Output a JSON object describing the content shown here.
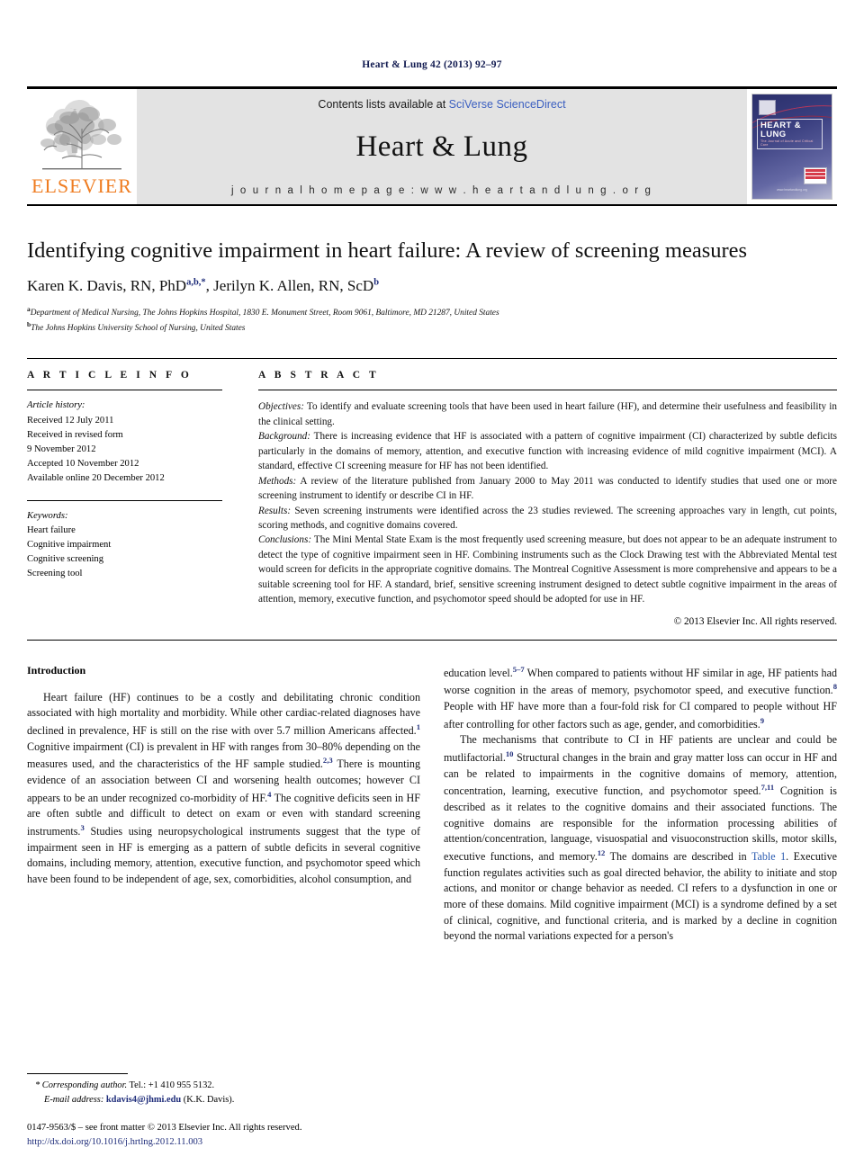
{
  "running_head": "Heart & Lung 42 (2013) 92–97",
  "masthead": {
    "publisher_name": "ELSEVIER",
    "publisher_logo_icon": "elsevier-tree-icon",
    "contents_prefix": "Contents lists available at ",
    "contents_link": "SciVerse ScienceDirect",
    "journal_title": "Heart & Lung",
    "homepage": "j o u r n a l   h o m e p a g e :   w w w . h e a r t a n d l u n g . o r g",
    "cover": {
      "title": "HEART & LUNG",
      "subtitle": "The Journal of Acute and Critical Care",
      "url": "www.heartandlung.org"
    }
  },
  "article": {
    "title": "Identifying cognitive impairment in heart failure: A review of screening measures",
    "authors": [
      {
        "name": "Karen K. Davis, RN, PhD",
        "marks": "a,b,*"
      },
      {
        "name": "Jerilyn K. Allen, RN, ScD",
        "marks": "b"
      }
    ],
    "authors_line_prefix": "Karen K. Davis, RN, PhD",
    "authors_line_mid": ", Jerilyn K. Allen, RN, ScD",
    "affiliations": [
      {
        "mark": "a",
        "text": "Department of Medical Nursing, The Johns Hopkins Hospital, 1830 E. Monument Street, Room 9061, Baltimore, MD 21287, United States"
      },
      {
        "mark": "b",
        "text": "The Johns Hopkins University School of Nursing, United States"
      }
    ]
  },
  "article_info": {
    "heading": "A R T I C L E   I N F O",
    "history_label": "Article history:",
    "history": [
      "Received 12 July 2011",
      "Received in revised form",
      "9 November 2012",
      "Accepted 10 November 2012",
      "Available online 20 December 2012"
    ],
    "keywords_label": "Keywords:",
    "keywords": [
      "Heart failure",
      "Cognitive impairment",
      "Cognitive screening",
      "Screening tool"
    ]
  },
  "abstract": {
    "heading": "A B S T R A C T",
    "sections": [
      {
        "label": "Objectives:",
        "text": " To identify and evaluate screening tools that have been used in heart failure (HF), and determine their usefulness and feasibility in the clinical setting."
      },
      {
        "label": "Background:",
        "text": " There is increasing evidence that HF is associated with a pattern of cognitive impairment (CI) characterized by subtle deficits particularly in the domains of memory, attention, and executive function with increasing evidence of mild cognitive impairment (MCI). A standard, effective CI screening measure for HF has not been identified."
      },
      {
        "label": "Methods:",
        "text": " A review of the literature published from January 2000 to May 2011 was conducted to identify studies that used one or more screening instrument to identify or describe CI in HF."
      },
      {
        "label": "Results:",
        "text": " Seven screening instruments were identified across the 23 studies reviewed. The screening approaches vary in length, cut points, scoring methods, and cognitive domains covered."
      },
      {
        "label": "Conclusions:",
        "text": " The Mini Mental State Exam is the most frequently used screening measure, but does not appear to be an adequate instrument to detect the type of cognitive impairment seen in HF. Combining instruments such as the Clock Drawing test with the Abbreviated Mental test would screen for deficits in the appropriate cognitive domains. The Montreal Cognitive Assessment is more comprehensive and appears to be a suitable screening tool for HF. A standard, brief, sensitive screening instrument designed to detect subtle cognitive impairment in the areas of attention, memory, executive function, and psychomotor speed should be adopted for use in HF."
      }
    ],
    "copyright": "© 2013 Elsevier Inc. All rights reserved."
  },
  "body": {
    "intro_heading": "Introduction",
    "left_paragraph_1_a": "Heart failure (HF) continues to be a costly and debilitating chronic condition associated with high mortality and morbidity. While other cardiac-related diagnoses have declined in prevalence, HF is still on the rise with over 5.7 million Americans affected.",
    "left_ref_1": "1",
    "left_paragraph_1_b": " Cognitive impairment (CI) is prevalent in HF with ranges from 30–80% depending on the measures used, and the characteristics of the HF sample studied.",
    "left_ref_2": "2,3",
    "left_paragraph_1_c": " There is mounting evidence of an association between CI and worsening health outcomes; however CI appears to be an under recognized co-morbidity of HF.",
    "left_ref_3": "4",
    "left_paragraph_1_d": " The cognitive deficits seen in HF are often subtle and difficult to detect on exam or even with standard screening instruments.",
    "left_ref_4": "3",
    "left_paragraph_1_e": " Studies using neuropsychological instruments suggest that the type of impairment seen in HF is emerging as a pattern of subtle deficits in several cognitive domains, including memory, attention, executive function, and psychomotor speed which have been found to be independent of age, sex, comorbidities, alcohol consumption, and",
    "right_paragraph_1_a": "education level.",
    "right_ref_1": "5–7",
    "right_paragraph_1_b": " When compared to patients without HF similar in age, HF patients had worse cognition in the areas of memory, psychomotor speed, and executive function.",
    "right_ref_2": "8",
    "right_paragraph_1_c": " People with HF have more than a four-fold risk for CI compared to people without HF after controlling for other factors such as age, gender, and comorbidities.",
    "right_ref_3": "9",
    "right_paragraph_2_a": "The mechanisms that contribute to CI in HF patients are unclear and could be mutlifactorial.",
    "right_ref_4": "10",
    "right_paragraph_2_b": " Structural changes in the brain and gray matter loss can occur in HF and can be related to impairments in the cognitive domains of memory, attention, concentration, learning, executive function, and psychomotor speed.",
    "right_ref_5": "7,11",
    "right_paragraph_2_c": " Cognition is described as it relates to the cognitive domains and their associated functions. The cognitive domains are responsible for the information processing abilities of attention/concentration, language, visuospatial and visuoconstruction skills, motor skills, executive functions, and memory.",
    "right_ref_6": "12",
    "right_paragraph_2_d1": " The domains are described in ",
    "right_table_link": "Table 1",
    "right_paragraph_2_d2": ". Executive function regulates activities such as goal directed behavior, the ability to initiate and stop actions, and monitor or change behavior as needed. CI refers to a dysfunction in one or more of these domains. Mild cognitive impairment (MCI) is a syndrome defined by a set of clinical, cognitive, and functional criteria, and is marked by a decline in cognition beyond the normal variations expected for a person's"
  },
  "footnotes": {
    "corresponding_label": "* Corresponding author.",
    "corresponding_tel": " Tel.: +1 410 955 5132.",
    "email_label": "E-mail address:",
    "email": "kdavis4@jhmi.edu",
    "email_suffix": " (K.K. Davis).",
    "issn_line": "0147-9563/$ – see front matter © 2013 Elsevier Inc. All rights reserved.",
    "doi_line": "http://dx.doi.org/10.1016/j.hrtlng.2012.11.003"
  },
  "colors": {
    "link_blue": "#2b5bb0",
    "header_navy": "#10194f",
    "elsevier_orange": "#ef7d22",
    "masthead_gray": "#e3e3e3"
  }
}
